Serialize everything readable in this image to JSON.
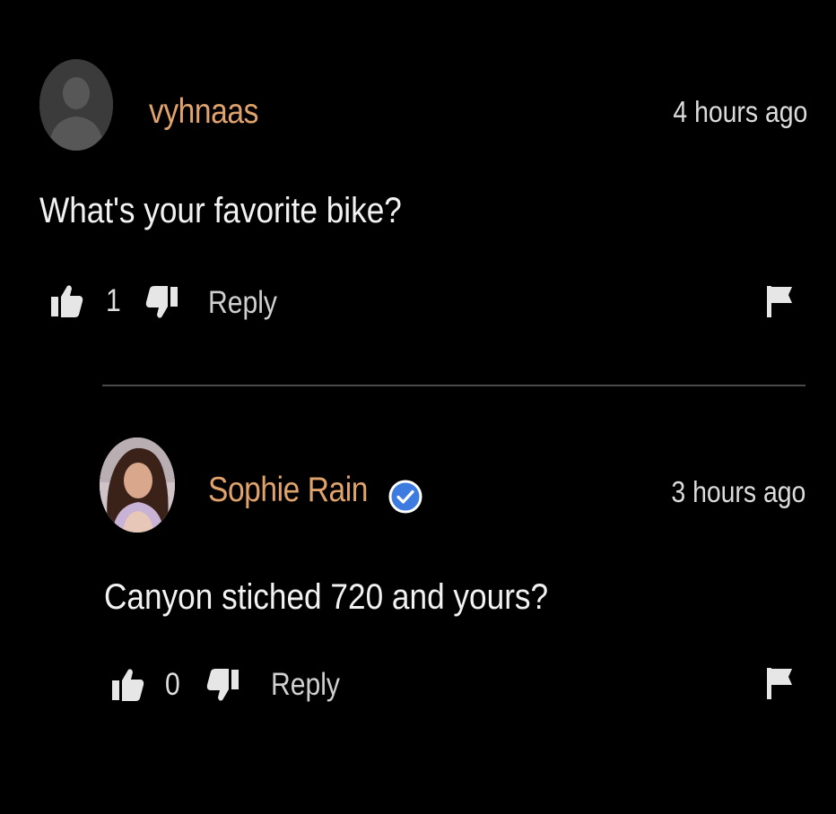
{
  "colors": {
    "background": "#000000",
    "username": "#e0a36c",
    "verified": "#3d7be0",
    "text": "#f2f2f2",
    "muted": "#d0d0d0"
  },
  "comments": [
    {
      "username": "vyhnaas",
      "time": "4 hours ago",
      "text": "What's your favorite bike?",
      "likes": "1",
      "reply_label": "Reply",
      "avatar": "default-avatar-icon",
      "verified": false
    },
    {
      "username": "Sophie Rain",
      "time": "3 hours ago",
      "text": "Canyon stiched 720 and yours?",
      "likes": "0",
      "reply_label": "Reply",
      "avatar": "profile-photo",
      "verified": true
    }
  ],
  "icons": {
    "like": "thumbs-up-icon",
    "dislike": "thumbs-down-icon",
    "flag": "flag-icon",
    "verified": "verified-check-icon"
  }
}
